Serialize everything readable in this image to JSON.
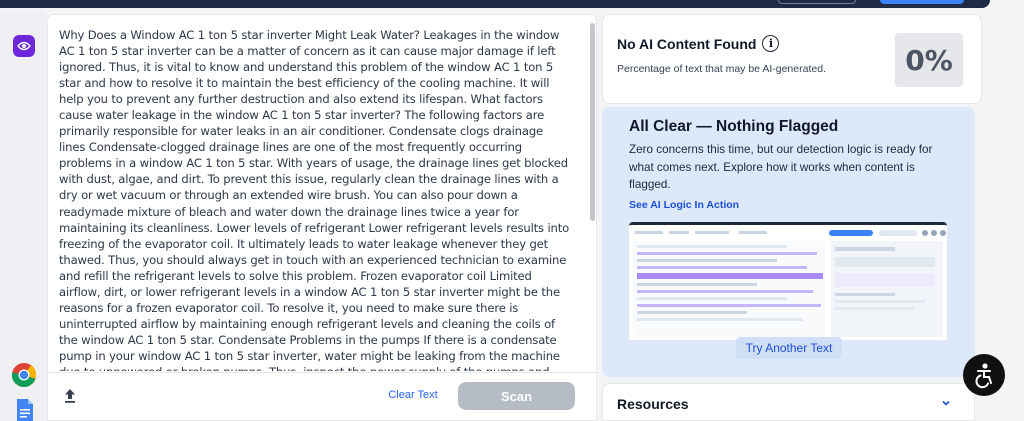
{
  "editor": {
    "text": "Why Does a Window AC 1 ton 5 star inverter Might Leak Water? Leakages in the window AC 1 ton 5 star inverter can be a matter of concern as it can cause major damage if left ignored. Thus, it is vital to know and understand this problem of the window AC 1 ton 5 star and how to resolve it to maintain the best efficiency of the cooling machine. It will help you to prevent any further destruction and also extend its lifespan. What factors cause water leakage in the window AC 1 ton 5 star inverter? The following factors are primarily responsible for water leaks in an air conditioner. Condensate clogs drainage lines Condensate-clogged drainage lines are one of the most frequently occurring problems in a window AC 1 ton 5 star. With years of usage, the drainage lines get blocked with dust, algae, and dirt. To prevent this issue, regularly clean the drainage lines with a dry or wet vacuum or through an extended wire brush. You can also pour down a readymade mixture of bleach and water down the drainage lines twice a year for maintaining its cleanliness. Lower levels of refrigerant Lower refrigerant levels results into freezing of the evaporator coil. It ultimately leads to water leakage whenever they get thawed. Thus, you should always get in touch with an experienced technician to examine and refill the refrigerant levels to solve this problem. Frozen evaporator coil Limited airflow, dirt, or lower refrigerant levels in a window AC 1 ton 5 star inverter might be the reasons for a frozen evaporator coil. To resolve it, you need to make sure there is uninterrupted airflow by maintaining enough refrigerant levels and cleaning the coils of the window AC 1 ton 5 star. Condensate Problems in the pumps If there is a condensate pump in your window AC 1 ton 5 star inverter, water might be leaking from the machine due to unpowered or broken pumps. Thus, inspect the power supply of the pumps and change them if there is any fault. Dirt in the air filters Dirt in the air filters can disturb the airflow and cause",
    "clear_label": "Clear Text",
    "scan_label": "Scan"
  },
  "summary": {
    "title": "No AI Content Found",
    "subtitle": "Percentage of text that may be AI-generated.",
    "percentage": "0%"
  },
  "panel": {
    "heading": "All Clear — Nothing Flagged",
    "description": "Zero concerns this time, but our detection logic is ready for what comes next. Explore how it works when content is flagged.",
    "link": "See AI Logic In Action",
    "try_label": "Try Another Text"
  },
  "resources": {
    "label": "Resources"
  },
  "icons": {
    "eye": "eye-icon",
    "chrome": "chrome-icon",
    "docs": "google-docs-icon",
    "upload": "upload-icon",
    "info": "info-icon",
    "chevron": "chevron-down-icon",
    "accessibility": "accessibility-icon"
  },
  "colors": {
    "accent_purple": "#6d28d9",
    "link_blue": "#2563eb",
    "panel_bg": "#dde9f9",
    "scan_disabled": "#b6bcc5"
  }
}
